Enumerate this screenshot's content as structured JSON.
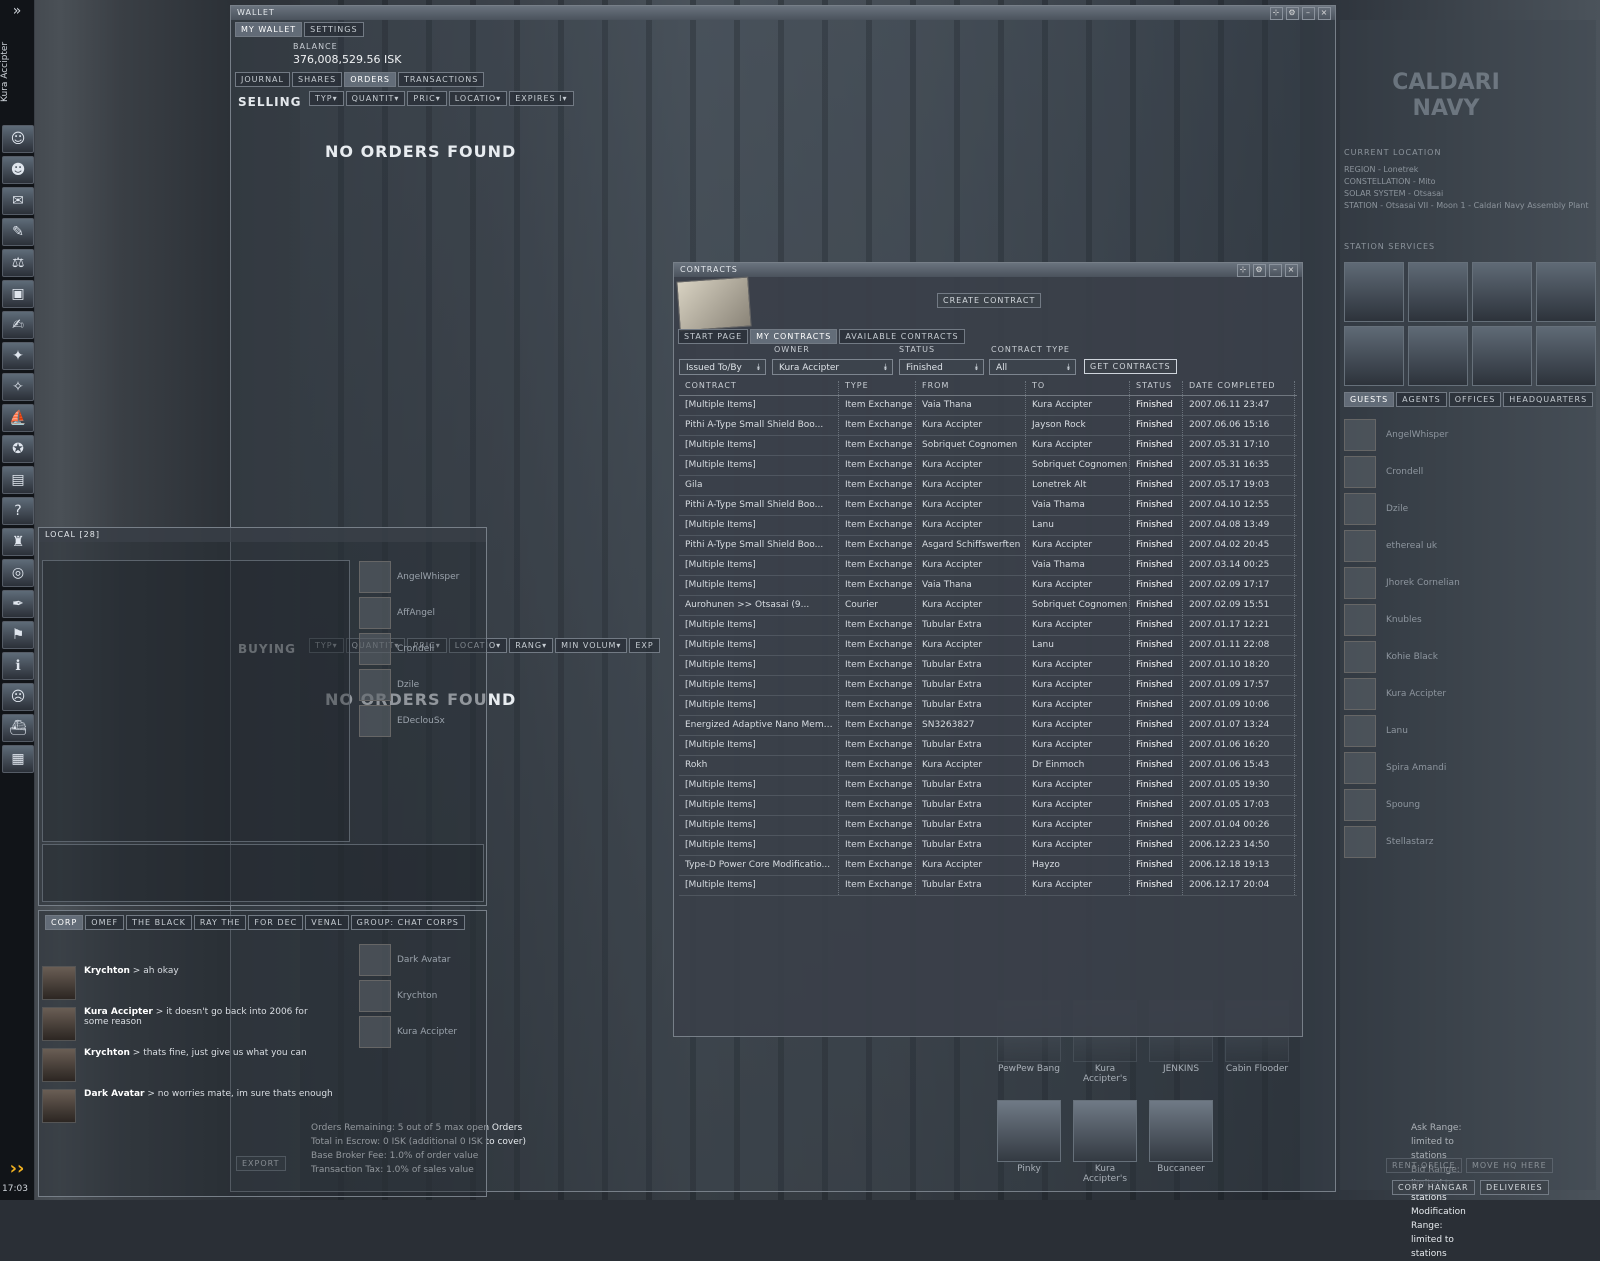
{
  "neocom": {
    "pilot_name": "Kura Accipter",
    "expand_glyph": "»",
    "clock": "17:03",
    "icons": [
      "character-sheet-icon",
      "people-icon",
      "mail-icon",
      "notepad-icon",
      "market-icon",
      "assets-icon",
      "journal-icon",
      "map-icon",
      "starmap-icon",
      "ship-icon",
      "skills-icon",
      "wallet-icon",
      "help-icon",
      "corporation-icon",
      "browser-icon",
      "contracts-icon",
      "fleet-icon",
      "info-icon",
      "portrait-icon",
      "ships-hangar-icon",
      "items-hangar-icon"
    ]
  },
  "wallet": {
    "title": "WALLET",
    "top_tabs": [
      "MY WALLET",
      "SETTINGS"
    ],
    "balance_label": "BALANCE",
    "balance_value": "376,008,529.56 ISK",
    "sub_tabs": [
      "JOURNAL",
      "SHARES",
      "ORDERS",
      "TRANSACTIONS"
    ],
    "selling_label": "SELLING",
    "selling_columns": [
      "TYP▾",
      "QUANTIT▾",
      "PRIC▾",
      "LOCATIO▾",
      "EXPIRES I▾"
    ],
    "selling_empty": "NO ORDERS FOUND",
    "buying_label": "BUYING",
    "buying_columns": [
      "TYP▾",
      "QUANTIT▾",
      "PRIC▾",
      "LOCATIO▾",
      "RANG▾",
      "MIN VOLUM▾",
      "EXP"
    ],
    "buying_empty": "NO ORDERS FOUND",
    "export_label": "EXPORT",
    "footer_lines": [
      "Orders Remaining: 5 out of 5 max open Orders",
      "Total in Escrow: 0 ISK (additional 0 ISK to cover)",
      "Base Broker Fee: 1.0% of order value",
      "Transaction Tax: 1.0% of sales value"
    ],
    "range_lines": [
      "Ask Range: limited to stations",
      "Bid Range: limited to stations",
      "Modification Range: limited to stations"
    ]
  },
  "local": {
    "title": "LOCAL [28]",
    "members": [
      "AngelWhisper",
      "AffAngel",
      "Crondell",
      "Dzile",
      "EDeclouSx"
    ]
  },
  "chat": {
    "tabs": [
      "CORP",
      "OMEF",
      "THE BLACK",
      "RAY THE",
      "FOR DEC",
      "VENAL",
      "GROUP: CHAT CORPS"
    ],
    "messages": [
      {
        "who": "Krychton",
        "text": "> ah okay"
      },
      {
        "who": "Kura Accipter",
        "text": "> it doesn't go back into 2006 for some reason"
      },
      {
        "who": "Krychton",
        "text": "> thats fine, just give us what you can"
      },
      {
        "who": "Dark Avatar",
        "text": "> no worries mate, im sure thats enough"
      }
    ],
    "members": [
      "Dark Avatar",
      "Krychton",
      "Kura Accipter"
    ]
  },
  "contracts": {
    "title": "CONTRACTS",
    "create_label": "CREATE CONTRACT",
    "tabs": [
      "START PAGE",
      "MY CONTRACTS",
      "AVAILABLE CONTRACTS"
    ],
    "owner_label": "OWNER",
    "status_label": "STATUS",
    "type_label": "CONTRACT TYPE",
    "issued_value": "Issued To/By",
    "owner_value": "Kura Accipter",
    "status_value": "Finished",
    "type_value": "All",
    "get_label": "GET CONTRACTS",
    "columns": [
      "CONTRACT",
      "TYPE",
      "FROM",
      "TO",
      "STATUS",
      "DATE COMPLETED"
    ],
    "rows": [
      [
        "[Multiple Items]",
        "Item Exchange",
        "Vaia Thana",
        "Kura Accipter",
        "Finished",
        "2007.06.11 23:47"
      ],
      [
        "Pithi A-Type Small Shield Boo...",
        "Item Exchange",
        "Kura Accipter",
        "Jayson Rock",
        "Finished",
        "2007.06.06 15:16"
      ],
      [
        "[Multiple Items]",
        "Item Exchange",
        "Sobriquet Cognomen",
        "Kura Accipter",
        "Finished",
        "2007.05.31 17:10"
      ],
      [
        "[Multiple Items]",
        "Item Exchange",
        "Kura Accipter",
        "Sobriquet Cognomen",
        "Finished",
        "2007.05.31 16:35"
      ],
      [
        "Gila",
        "Item Exchange",
        "Kura Accipter",
        "Lonetrek Alt",
        "Finished",
        "2007.05.17 19:03"
      ],
      [
        "Pithi A-Type Small Shield Boo...",
        "Item Exchange",
        "Kura Accipter",
        "Vaia Thama",
        "Finished",
        "2007.04.10 12:55"
      ],
      [
        "[Multiple Items]",
        "Item Exchange",
        "Kura Accipter",
        "Lanu",
        "Finished",
        "2007.04.08 13:49"
      ],
      [
        "Pithi A-Type Small Shield Boo...",
        "Item Exchange",
        "Asgard Schiffswerften",
        "Kura Accipter",
        "Finished",
        "2007.04.02 20:45"
      ],
      [
        "[Multiple Items]",
        "Item Exchange",
        "Kura Accipter",
        "Vaia Thama",
        "Finished",
        "2007.03.14 00:25"
      ],
      [
        "[Multiple Items]",
        "Item Exchange",
        "Vaia Thana",
        "Kura Accipter",
        "Finished",
        "2007.02.09 17:17"
      ],
      [
        "Aurohunen >> Otsasai (9...",
        "Courier",
        "Kura Accipter",
        "Sobriquet Cognomen",
        "Finished",
        "2007.02.09 15:51"
      ],
      [
        "[Multiple Items]",
        "Item Exchange",
        "Tubular Extra",
        "Kura Accipter",
        "Finished",
        "2007.01.17 12:21"
      ],
      [
        "[Multiple Items]",
        "Item Exchange",
        "Kura Accipter",
        "Lanu",
        "Finished",
        "2007.01.11 22:08"
      ],
      [
        "[Multiple Items]",
        "Item Exchange",
        "Tubular Extra",
        "Kura Accipter",
        "Finished",
        "2007.01.10 18:20"
      ],
      [
        "[Multiple Items]",
        "Item Exchange",
        "Tubular Extra",
        "Kura Accipter",
        "Finished",
        "2007.01.09 17:57"
      ],
      [
        "[Multiple Items]",
        "Item Exchange",
        "Tubular Extra",
        "Kura Accipter",
        "Finished",
        "2007.01.09 10:06"
      ],
      [
        "Energized Adaptive Nano Membr...",
        "Item Exchange",
        "SN3263827",
        "Kura Accipter",
        "Finished",
        "2007.01.07 13:24"
      ],
      [
        "[Multiple Items]",
        "Item Exchange",
        "Tubular Extra",
        "Kura Accipter",
        "Finished",
        "2007.01.06 16:20"
      ],
      [
        "Rokh",
        "Item Exchange",
        "Kura Accipter",
        "Dr Einmoch",
        "Finished",
        "2007.01.06 15:43"
      ],
      [
        "[Multiple Items]",
        "Item Exchange",
        "Tubular Extra",
        "Kura Accipter",
        "Finished",
        "2007.01.05 19:30"
      ],
      [
        "[Multiple Items]",
        "Item Exchange",
        "Tubular Extra",
        "Kura Accipter",
        "Finished",
        "2007.01.05 17:03"
      ],
      [
        "[Multiple Items]",
        "Item Exchange",
        "Tubular Extra",
        "Kura Accipter",
        "Finished",
        "2007.01.04 00:26"
      ],
      [
        "[Multiple Items]",
        "Item Exchange",
        "Tubular Extra",
        "Kura Accipter",
        "Finished",
        "2006.12.23 14:50"
      ],
      [
        "Type-D Power Core Modificatio...",
        "Item Exchange",
        "Kura Accipter",
        "Hayzo",
        "Finished",
        "2006.12.18 19:13"
      ],
      [
        "[Multiple Items]",
        "Item Exchange",
        "Tubular Extra",
        "Kura Accipter",
        "Finished",
        "2006.12.17 20:04"
      ]
    ]
  },
  "station": {
    "faction": "CALDARI NAVY",
    "location_label": "CURRENT LOCATION",
    "location_lines": [
      "REGION - Lonetrek",
      "CONSTELLATION - Mito",
      "SOLAR SYSTEM - Otsasai",
      "STATION - Otsasai VII - Moon 1 - Caldari Navy Assembly Plant"
    ],
    "services_label": "STATION SERVICES",
    "tabs": [
      "GUESTS",
      "AGENTS",
      "OFFICES",
      "HEADQUARTERS"
    ],
    "guests": [
      "AngelWhisper",
      "Crondell",
      "Dzile",
      "ethereal uk",
      "Jhorek Cornelian",
      "Knubles",
      "Kohie Black",
      "Kura Accipter",
      "Lanu",
      "Spira Amandi",
      "Spoung",
      "Stellastarz"
    ],
    "ships": [
      "PewPew Bang",
      "Kura Accipter's",
      "JENKINS",
      "Cabin Flooder",
      "Pinky",
      "Kura Accipter's",
      "Buccaneer"
    ],
    "corp_hangar": "CORP HANGAR",
    "deliveries": "DELIVERIES",
    "rent_office": "RENT OFFICE",
    "move_hq": "MOVE HQ HERE"
  }
}
